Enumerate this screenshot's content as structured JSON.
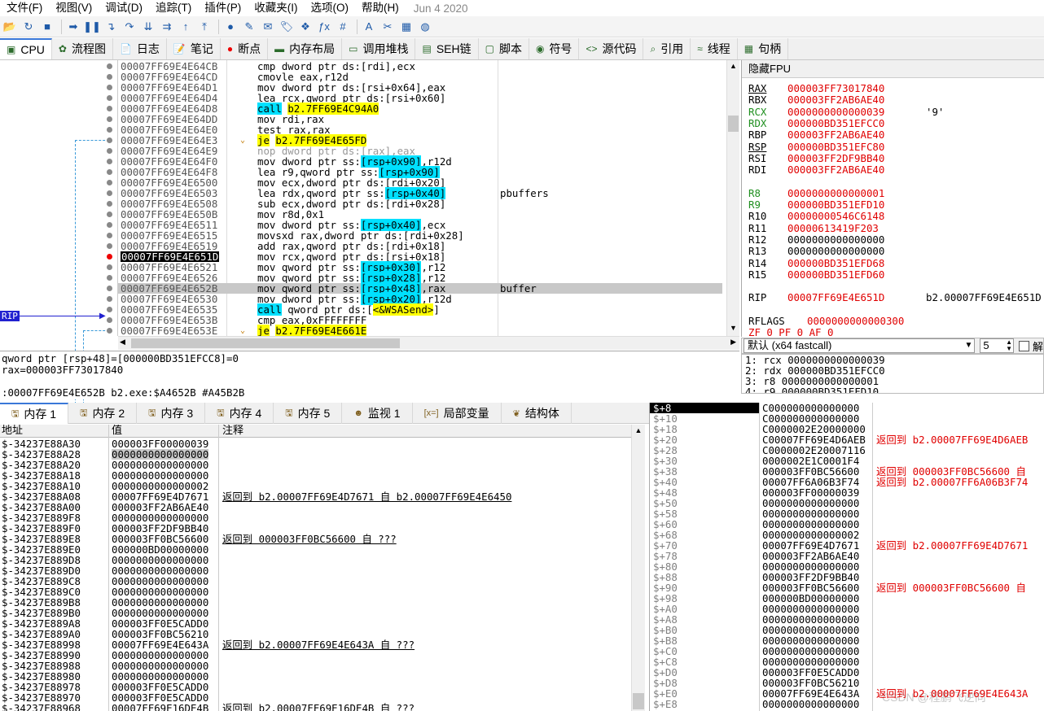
{
  "menu": [
    "文件(F)",
    "视图(V)",
    "调试(D)",
    "追踪(T)",
    "插件(P)",
    "收藏夹(I)",
    "选项(O)",
    "帮助(H)"
  ],
  "date": "Jun 4 2020",
  "toolbar_icons": [
    "open-icon",
    "restart-icon",
    "stop-icon",
    "run-icon",
    "pause-icon",
    "step-into-icon",
    "step-over-icon",
    "trace-into-icon",
    "trace-over-icon",
    "execute-till-return-icon",
    "run-to-user-code-icon",
    "breakpoint-icon",
    "patch-icon",
    "comment-icon",
    "label-icon",
    "bookmark-icon",
    "function-icon",
    "hash-icon",
    "font-icon",
    "scylla-icon",
    "calculator-icon",
    "globe-icon"
  ],
  "main_tabs": [
    {
      "label": "CPU",
      "icon": "cpu-icon"
    },
    {
      "label": "流程图",
      "icon": "graph-icon"
    },
    {
      "label": "日志",
      "icon": "log-icon"
    },
    {
      "label": "笔记",
      "icon": "notes-icon"
    },
    {
      "label": "断点",
      "icon": "breakpoint-dot-icon"
    },
    {
      "label": "内存布局",
      "icon": "memory-map-icon"
    },
    {
      "label": "调用堆栈",
      "icon": "call-stack-icon"
    },
    {
      "label": "SEH链",
      "icon": "seh-icon"
    },
    {
      "label": "脚本",
      "icon": "script-icon"
    },
    {
      "label": "符号",
      "icon": "symbols-icon"
    },
    {
      "label": "源代码",
      "icon": "source-icon"
    },
    {
      "label": "引用",
      "icon": "references-icon"
    },
    {
      "label": "线程",
      "icon": "threads-icon"
    },
    {
      "label": "句柄",
      "icon": "handles-icon"
    }
  ],
  "rip_label": "RIP",
  "disasm": [
    {
      "addr": "00007FF69E4E64CB",
      "instr": [
        [
          "cmp dword ptr ",
          ""
        ],
        [
          "ds",
          ""
        ],
        [
          ":[",
          ""
        ],
        [
          "rdi",
          "r"
        ],
        [
          "],",
          ""
        ],
        [
          "ecx",
          "r"
        ]
      ],
      "cmt": ""
    },
    {
      "addr": "00007FF69E4E64CD",
      "instr": [
        [
          "cmovle ",
          ""
        ],
        [
          "eax",
          "r"
        ],
        [
          ",",
          ""
        ],
        [
          "r12d",
          "r"
        ]
      ],
      "cmt": ""
    },
    {
      "addr": "00007FF69E4E64D1",
      "instr": [
        [
          "mov dword ptr ds:[",
          ""
        ],
        [
          "rsi",
          "r"
        ],
        [
          "+0x64],",
          ""
        ],
        [
          "eax",
          "r"
        ]
      ],
      "cmt": ""
    },
    {
      "addr": "00007FF69E4E64D4",
      "instr": [
        [
          "lea ",
          ""
        ],
        [
          "rcx",
          "r"
        ],
        [
          ",qword ptr ds:[",
          ""
        ],
        [
          "rsi",
          "r"
        ],
        [
          "+0x60]",
          ""
        ]
      ],
      "cmt": ""
    },
    {
      "addr": "00007FF69E4E64D8",
      "instr": [
        [
          "call",
          "c"
        ],
        [
          " ",
          ""
        ],
        [
          "b2.7FF69E4C94A0",
          "y"
        ]
      ],
      "cmt": ""
    },
    {
      "addr": "00007FF69E4E64DD",
      "instr": [
        [
          "mov ",
          ""
        ],
        [
          "rdi",
          "r"
        ],
        [
          ",",
          ""
        ],
        [
          "rax",
          "r"
        ]
      ],
      "cmt": ""
    },
    {
      "addr": "00007FF69E4E64E0",
      "instr": [
        [
          "test ",
          ""
        ],
        [
          "rax",
          "r"
        ],
        [
          ",",
          ""
        ],
        [
          "rax",
          "r"
        ]
      ],
      "cmt": ""
    },
    {
      "addr": "00007FF69E4E64E3",
      "instr": [
        [
          "je",
          "y"
        ],
        [
          " ",
          ""
        ],
        [
          "b2.7FF69E4E65FD",
          "y"
        ]
      ],
      "cmt": "",
      "arrow": "v"
    },
    {
      "addr": "00007FF69E4E64E9",
      "instr": [
        [
          "nop dword ptr ds:[rax],eax",
          "g"
        ]
      ],
      "cmt": ""
    },
    {
      "addr": "00007FF69E4E64F0",
      "instr": [
        [
          "mov dword ptr ss:",
          ""
        ],
        [
          "[rsp+0x90]",
          "c"
        ],
        [
          ",",
          ""
        ],
        [
          "r12d",
          "r"
        ]
      ],
      "cmt": ""
    },
    {
      "addr": "00007FF69E4E64F8",
      "instr": [
        [
          "lea ",
          ""
        ],
        [
          "r9",
          "r"
        ],
        [
          ",qword ptr ss:",
          ""
        ],
        [
          "[rsp+0x90]",
          "c"
        ]
      ],
      "cmt": ""
    },
    {
      "addr": "00007FF69E4E6500",
      "instr": [
        [
          "mov ",
          ""
        ],
        [
          "ecx",
          "r"
        ],
        [
          ",dword ptr ds:[",
          ""
        ],
        [
          "rdi",
          "r"
        ],
        [
          "+0x20]",
          ""
        ]
      ],
      "cmt": ""
    },
    {
      "addr": "00007FF69E4E6503",
      "instr": [
        [
          "lea ",
          ""
        ],
        [
          "rdx",
          "r"
        ],
        [
          ",qword ptr ss:",
          ""
        ],
        [
          "[rsp+0x40]",
          "c"
        ]
      ],
      "cmt": "pbuffers"
    },
    {
      "addr": "00007FF69E4E6508",
      "instr": [
        [
          "sub ",
          ""
        ],
        [
          "ecx",
          "r"
        ],
        [
          ",dword ptr ds:[",
          ""
        ],
        [
          "rdi",
          "r"
        ],
        [
          "+0x28]",
          ""
        ]
      ],
      "cmt": ""
    },
    {
      "addr": "00007FF69E4E650B",
      "instr": [
        [
          "mov ",
          ""
        ],
        [
          "r8d",
          "r"
        ],
        [
          ",0x1",
          ""
        ]
      ],
      "cmt": ""
    },
    {
      "addr": "00007FF69E4E6511",
      "instr": [
        [
          "mov dword ptr ss:",
          ""
        ],
        [
          "[rsp+0x40]",
          "c"
        ],
        [
          ",",
          ""
        ],
        [
          "ecx",
          "r"
        ]
      ],
      "cmt": ""
    },
    {
      "addr": "00007FF69E4E6515",
      "instr": [
        [
          "movsxd ",
          ""
        ],
        [
          "rax",
          "r"
        ],
        [
          ",dword ptr ds:[",
          ""
        ],
        [
          "rdi",
          "r"
        ],
        [
          "+0x28]",
          ""
        ]
      ],
      "cmt": ""
    },
    {
      "addr": "00007FF69E4E6519",
      "instr": [
        [
          "add ",
          ""
        ],
        [
          "rax",
          "r"
        ],
        [
          ",qword ptr ds:[",
          ""
        ],
        [
          "rdi",
          "r"
        ],
        [
          "+0x18]",
          ""
        ]
      ],
      "cmt": ""
    },
    {
      "addr": "00007FF69E4E651D",
      "instr": [
        [
          "mov ",
          ""
        ],
        [
          "rcx",
          "r"
        ],
        [
          ",qword ptr ds:[",
          ""
        ],
        [
          "rsi",
          "r"
        ],
        [
          "+0x18]",
          ""
        ]
      ],
      "cmt": "",
      "rip": true
    },
    {
      "addr": "00007FF69E4E6521",
      "instr": [
        [
          "mov qword ptr ss:",
          ""
        ],
        [
          "[rsp+0x30]",
          "c"
        ],
        [
          ",",
          ""
        ],
        [
          "r12",
          "r"
        ]
      ],
      "cmt": ""
    },
    {
      "addr": "00007FF69E4E6526",
      "instr": [
        [
          "mov qword ptr ss:",
          ""
        ],
        [
          "[rsp+0x28]",
          "c"
        ],
        [
          ",",
          ""
        ],
        [
          "r12",
          "r"
        ]
      ],
      "cmt": ""
    },
    {
      "addr": "00007FF69E4E652B",
      "instr": [
        [
          "mov qword ptr ss:",
          ""
        ],
        [
          "[rsp+0x48]",
          "c"
        ],
        [
          ",",
          ""
        ],
        [
          "rax",
          "r"
        ]
      ],
      "cmt": "buffer",
      "sel": true
    },
    {
      "addr": "00007FF69E4E6530",
      "instr": [
        [
          "mov dword ptr ss:",
          ""
        ],
        [
          "[rsp+0x20]",
          "c"
        ],
        [
          ",",
          ""
        ],
        [
          "r12d",
          "r"
        ]
      ],
      "cmt": ""
    },
    {
      "addr": "00007FF69E4E6535",
      "instr": [
        [
          "call",
          "c"
        ],
        [
          " qword ptr ds:[",
          ""
        ],
        [
          "<&WSASend>",
          "y"
        ],
        [
          "]",
          ""
        ]
      ],
      "cmt": ""
    },
    {
      "addr": "00007FF69E4E653B",
      "instr": [
        [
          "cmp ",
          ""
        ],
        [
          "eax",
          "r"
        ],
        [
          ",0xFFFFFFFF",
          ""
        ]
      ],
      "cmt": ""
    },
    {
      "addr": "00007FF69E4E653E",
      "instr": [
        [
          "je",
          "y"
        ],
        [
          " ",
          ""
        ],
        [
          "b2.7FF69E4E661E",
          "y"
        ]
      ],
      "cmt": "",
      "arrow": "v"
    }
  ],
  "info": [
    "qword ptr [rsp+48]=[000000BD351EFCC8]=0",
    "rax=000003FF73017840",
    "",
    "       :00007FF69E4E652B b2.exe:$A4652B #A45B2B"
  ],
  "reg_header": "隐藏FPU",
  "registers": [
    {
      "name": "RAX",
      "value": "000003FF73017840",
      "u": true
    },
    {
      "name": "RBX",
      "value": "000003FF2AB6AE40"
    },
    {
      "name": "RCX",
      "value": "0000000000000039",
      "extra": "'9'",
      "g": true
    },
    {
      "name": "RDX",
      "value": "000000BD351EFCC0",
      "g": true
    },
    {
      "name": "RBP",
      "value": "000003FF2AB6AE40"
    },
    {
      "name": "RSP",
      "value": "000000BD351EFC80",
      "u": true
    },
    {
      "name": "RSI",
      "value": "000003FF2DF9BB40"
    },
    {
      "name": "RDI",
      "value": "000003FF2AB6AE40"
    },
    {
      "name": "",
      "value": ""
    },
    {
      "name": "R8",
      "value": "0000000000000001",
      "g": true
    },
    {
      "name": "R9",
      "value": "000000BD351EFD10",
      "g": true
    },
    {
      "name": "R10",
      "value": "00000000546C6148"
    },
    {
      "name": "R11",
      "value": "00000613419F203"
    },
    {
      "name": "R12",
      "value": "0000000000000000",
      "black": true
    },
    {
      "name": "R13",
      "value": "0000000000000000",
      "black": true
    },
    {
      "name": "R14",
      "value": "000000BD351EFD68"
    },
    {
      "name": "R15",
      "value": "000000BD351EFD60"
    },
    {
      "name": "",
      "value": ""
    },
    {
      "name": "RIP",
      "value": "00007FF69E4E651D",
      "extra": "b2.00007FF69E4E651D"
    },
    {
      "name": "",
      "value": ""
    },
    {
      "name": "RFLAGS",
      "value": "0000000000000300"
    },
    {
      "name": "ZF 0   PF 0   AF 0",
      "value": ""
    }
  ],
  "callconv": {
    "value": "默认 (x64 fastcall)",
    "count": "5",
    "lock_label": "解"
  },
  "args": [
    "1: rcx 0000000000000039",
    "2: rdx 000000BD351EFCC0",
    "3: r8 0000000000000001",
    "4: r9 000000BD351EFD10"
  ],
  "mem_tabs": [
    {
      "label": "内存 1",
      "icon": "memory-dump-icon"
    },
    {
      "label": "内存 2",
      "icon": "memory-dump-icon"
    },
    {
      "label": "内存 3",
      "icon": "memory-dump-icon"
    },
    {
      "label": "内存 4",
      "icon": "memory-dump-icon"
    },
    {
      "label": "内存 5",
      "icon": "memory-dump-icon"
    },
    {
      "label": "监视 1",
      "icon": "watch-icon"
    },
    {
      "label": "局部变量",
      "icon": "locals-icon"
    },
    {
      "label": "结构体",
      "icon": "struct-icon"
    }
  ],
  "mem_cols": {
    "addr": "地址",
    "val": "值",
    "cmt": "注释"
  },
  "mem_rows": [
    [
      "$-34237E88A30",
      "000003FF00000039",
      ""
    ],
    [
      "$-34237E88A28",
      "0000000000000000",
      ""
    ],
    [
      "$-34237E88A20",
      "0000000000000000",
      ""
    ],
    [
      "$-34237E88A18",
      "0000000000000000",
      ""
    ],
    [
      "$-34237E88A10",
      "0000000000000002",
      ""
    ],
    [
      "$-34237E88A08",
      "00007FF69E4D7671",
      "返回到 b2.00007FF69E4D7671 自 b2.00007FF69E4E6450"
    ],
    [
      "$-34237E88A00",
      "000003FF2AB6AE40",
      ""
    ],
    [
      "$-34237E889F8",
      "0000000000000000",
      ""
    ],
    [
      "$-34237E889F0",
      "000003FF2DF9BB40",
      ""
    ],
    [
      "$-34237E889E8",
      "000003FF0BC56600",
      "返回到 000003FF0BC56600 自 ???"
    ],
    [
      "$-34237E889E0",
      "000000BD00000000",
      ""
    ],
    [
      "$-34237E889D8",
      "0000000000000000",
      ""
    ],
    [
      "$-34237E889D0",
      "0000000000000000",
      ""
    ],
    [
      "$-34237E889C8",
      "0000000000000000",
      ""
    ],
    [
      "$-34237E889C0",
      "0000000000000000",
      ""
    ],
    [
      "$-34237E889B8",
      "0000000000000000",
      ""
    ],
    [
      "$-34237E889B0",
      "0000000000000000",
      ""
    ],
    [
      "$-34237E889A8",
      "000003FF0E5CADD0",
      ""
    ],
    [
      "$-34237E889A0",
      "000003FF0BC56210",
      ""
    ],
    [
      "$-34237E88998",
      "00007FF69E4E643A",
      "返回到 b2.00007FF69E4E643A 自 ???"
    ],
    [
      "$-34237E88990",
      "0000000000000000",
      ""
    ],
    [
      "$-34237E88988",
      "0000000000000000",
      ""
    ],
    [
      "$-34237E88980",
      "0000000000000000",
      ""
    ],
    [
      "$-34237E88978",
      "000003FF0E5CADD0",
      ""
    ],
    [
      "$-34237E88970",
      "000003FF0E5CADD0",
      ""
    ],
    [
      "$-34237E88968",
      "00007FF69E16DE4B",
      "返回到 b2.00007FF69E16DE4B 自 ???"
    ]
  ],
  "stack_rows": [
    [
      "$+8",
      "C000000000000000",
      ""
    ],
    [
      "$+10",
      "C000000000000000",
      ""
    ],
    [
      "$+18",
      "C0000002E20000000",
      ""
    ],
    [
      "$+20",
      "C00007FF69E4D6AEB",
      "返回到 b2.00007FF69E4D6AEB"
    ],
    [
      "$+28",
      "C0000002E20007116",
      ""
    ],
    [
      "$+30",
      "0000002E1C0001F4",
      ""
    ],
    [
      "$+38",
      "000003FF0BC56600",
      "返回到 000003FF0BC56600 自"
    ],
    [
      "$+40",
      "00007FF6A06B3F74",
      "返回到 b2.00007FF6A06B3F74"
    ],
    [
      "$+48",
      "000003FF00000039",
      ""
    ],
    [
      "$+50",
      "0000000000000000",
      ""
    ],
    [
      "$+58",
      "0000000000000000",
      ""
    ],
    [
      "$+60",
      "0000000000000000",
      ""
    ],
    [
      "$+68",
      "0000000000000002",
      ""
    ],
    [
      "$+70",
      "00007FF69E4D7671",
      "返回到 b2.00007FF69E4D7671"
    ],
    [
      "$+78",
      "000003FF2AB6AE40",
      ""
    ],
    [
      "$+80",
      "0000000000000000",
      ""
    ],
    [
      "$+88",
      "000003FF2DF9BB40",
      ""
    ],
    [
      "$+90",
      "000003FF0BC56600",
      "返回到 000003FF0BC56600 自"
    ],
    [
      "$+98",
      "000000BD00000000",
      ""
    ],
    [
      "$+A0",
      "0000000000000000",
      ""
    ],
    [
      "$+A8",
      "0000000000000000",
      ""
    ],
    [
      "$+B0",
      "0000000000000000",
      ""
    ],
    [
      "$+B8",
      "0000000000000000",
      ""
    ],
    [
      "$+C0",
      "0000000000000000",
      ""
    ],
    [
      "$+C8",
      "0000000000000000",
      ""
    ],
    [
      "$+D0",
      "000003FF0E5CADD0",
      ""
    ],
    [
      "$+D8",
      "000003FF0BC56210",
      ""
    ],
    [
      "$+E0",
      "00007FF69E4E643A",
      "返回到 b2.00007FF69E4E643A"
    ],
    [
      "$+E8",
      "0000000000000000",
      ""
    ]
  ],
  "watermark": "CSDN @程鹏飞逆向"
}
